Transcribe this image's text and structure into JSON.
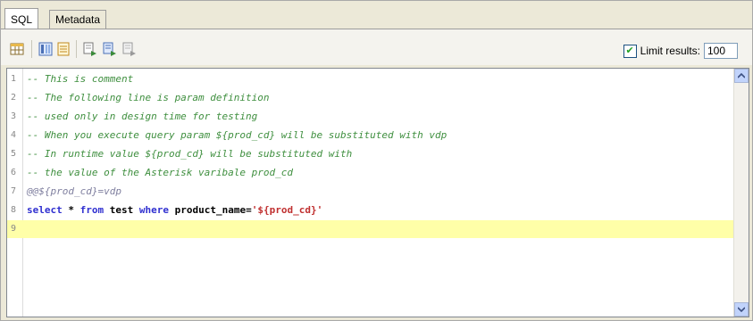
{
  "tabs": [
    {
      "label": "SQL",
      "active": true
    },
    {
      "label": "Metadata",
      "active": false
    }
  ],
  "toolbar": {
    "icons": [
      "table-grid-icon",
      "column-view-icon",
      "document-icon",
      "execute-icon",
      "execute-all-icon",
      "stop-icon"
    ],
    "limit_checked": true,
    "limit_label": "Limit results:",
    "limit_value": "100"
  },
  "editor": {
    "current_line": 9,
    "lines": [
      {
        "num": "1",
        "text": "-- This is comment"
      },
      {
        "num": "2",
        "text": "-- The following line is param definition"
      },
      {
        "num": "3",
        "text": "-- used only in design time for testing"
      },
      {
        "num": "4",
        "text": "-- When you execute query param ${prod_cd} will be substituted with vdp"
      },
      {
        "num": "5",
        "text": "-- In runtime value ${prod_cd} will be substituted with"
      },
      {
        "num": "6",
        "text": "-- the value of the Asterisk varibale prod_cd"
      },
      {
        "num": "7",
        "text": "@@${prod_cd}=vdp"
      },
      {
        "num": "8",
        "kw1": "select",
        "t1": " * ",
        "kw2": "from",
        "t2": " test ",
        "kw3": "where",
        "t3": " product_name=",
        "str": "'${prod_cd}'"
      },
      {
        "num": "9",
        "text": ""
      }
    ]
  },
  "colors": {
    "comment": "#3f8f3f",
    "keyword": "#3030d0",
    "string": "#c03030",
    "current_line": "#ffffa8"
  }
}
